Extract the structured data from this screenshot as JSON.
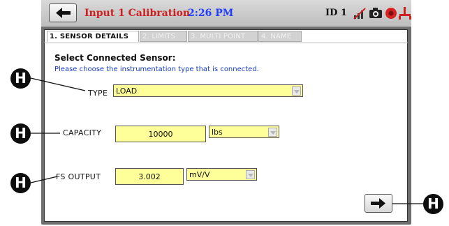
{
  "titlebar": {
    "title": "Input 1 Calibration",
    "time": "2:26 PM",
    "device_id": "ID 1",
    "icons": [
      "back-arrow-icon",
      "no-signal-icon",
      "camera-icon",
      "record-icon",
      "usb-icon"
    ]
  },
  "tabs": [
    {
      "label": "1. SENSOR DETAILS",
      "active": true
    },
    {
      "label": "2. LIMITS",
      "active": false
    },
    {
      "label": "3. MULTI POINT",
      "active": false
    },
    {
      "label": "4. NAME",
      "active": false
    }
  ],
  "form": {
    "heading": "Select Connected Sensor:",
    "subtext": "Please choose the instrumentation type that is connected.",
    "type": {
      "label": "TYPE",
      "value": "LOAD"
    },
    "capacity": {
      "label": "CAPACITY",
      "value": "10000",
      "unit": "lbs"
    },
    "fs_output": {
      "label": "FS OUTPUT",
      "value": "3.002",
      "unit": "mV/V"
    }
  },
  "callouts": {
    "marker": "H"
  },
  "colors": {
    "title": "#cc1f1f",
    "time": "#1f3cff",
    "field_bg": "#ffff99",
    "subtext": "#1a3cc8"
  }
}
